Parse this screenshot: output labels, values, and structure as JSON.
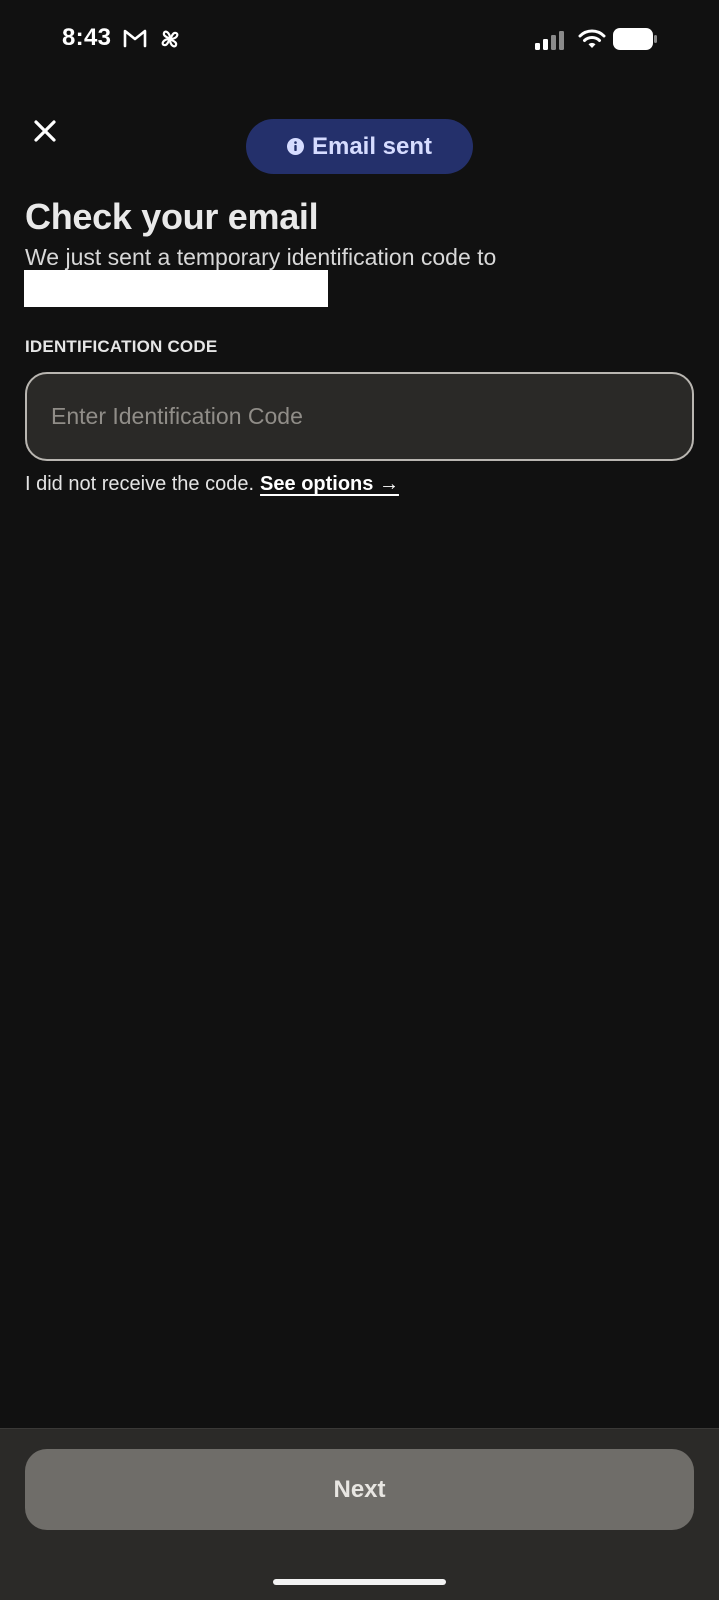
{
  "status_bar": {
    "time": "8:43",
    "icons": [
      "gmail-icon",
      "slack-icon",
      "cellular-signal-icon",
      "wifi-icon",
      "battery-icon"
    ]
  },
  "toast": {
    "label": "Email sent",
    "icon": "info-icon",
    "background": "#24306b"
  },
  "header": {
    "close_icon": "close-icon"
  },
  "main": {
    "title": "Check your email",
    "subtitle": "We just sent a temporary identification code to",
    "field_label": "IDENTIFICATION CODE",
    "code_input": {
      "value": "",
      "placeholder": "Enter Identification Code"
    },
    "help_text": "I did not receive the code.",
    "help_link": "See options →"
  },
  "footer": {
    "next_label": "Next"
  }
}
